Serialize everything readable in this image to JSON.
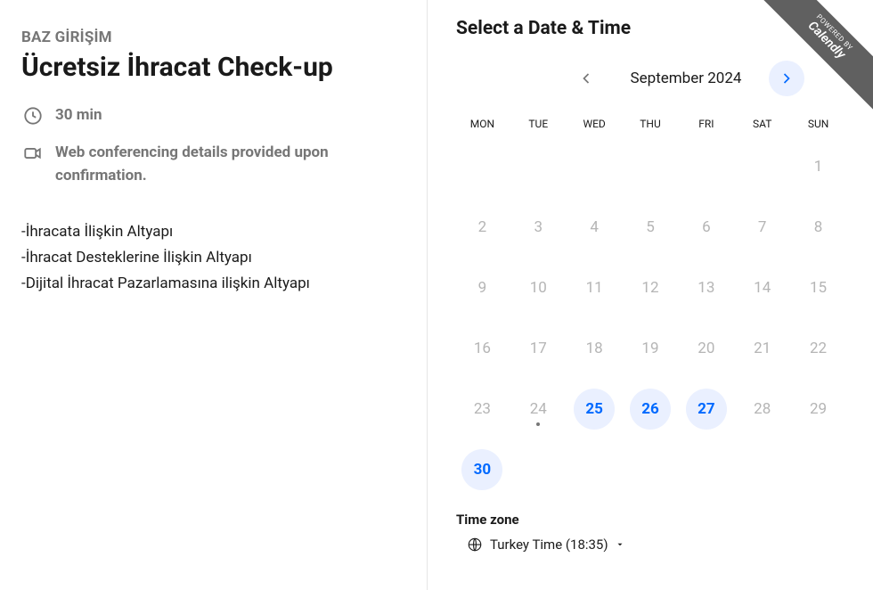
{
  "left": {
    "company": "BAZ GİRİŞİM",
    "title": "Ücretsiz İhracat Check-up",
    "duration": "30 min",
    "conferencing": "Web conferencing details provided upon confirmation.",
    "desc_line1": "-İhracata İlişkin Altyapı",
    "desc_line2": "-İhracat Desteklerine İlişkin Altyapı",
    "desc_line3": "-Dijital İhracat Pazarlamasına ilişkin Altyapı"
  },
  "right": {
    "heading": "Select a Date & Time",
    "month": "September 2024",
    "weekdays": [
      "MON",
      "TUE",
      "WED",
      "THU",
      "FRI",
      "SAT",
      "SUN"
    ],
    "days": [
      {
        "n": "",
        "cls": "empty"
      },
      {
        "n": "",
        "cls": "empty"
      },
      {
        "n": "",
        "cls": "empty"
      },
      {
        "n": "",
        "cls": "empty"
      },
      {
        "n": "",
        "cls": "empty"
      },
      {
        "n": "",
        "cls": "empty"
      },
      {
        "n": "1",
        "cls": ""
      },
      {
        "n": "2",
        "cls": ""
      },
      {
        "n": "3",
        "cls": ""
      },
      {
        "n": "4",
        "cls": ""
      },
      {
        "n": "5",
        "cls": ""
      },
      {
        "n": "6",
        "cls": ""
      },
      {
        "n": "7",
        "cls": ""
      },
      {
        "n": "8",
        "cls": ""
      },
      {
        "n": "9",
        "cls": ""
      },
      {
        "n": "10",
        "cls": ""
      },
      {
        "n": "11",
        "cls": ""
      },
      {
        "n": "12",
        "cls": ""
      },
      {
        "n": "13",
        "cls": ""
      },
      {
        "n": "14",
        "cls": ""
      },
      {
        "n": "15",
        "cls": ""
      },
      {
        "n": "16",
        "cls": ""
      },
      {
        "n": "17",
        "cls": ""
      },
      {
        "n": "18",
        "cls": ""
      },
      {
        "n": "19",
        "cls": ""
      },
      {
        "n": "20",
        "cls": ""
      },
      {
        "n": "21",
        "cls": ""
      },
      {
        "n": "22",
        "cls": ""
      },
      {
        "n": "23",
        "cls": ""
      },
      {
        "n": "24",
        "cls": "today"
      },
      {
        "n": "25",
        "cls": "available"
      },
      {
        "n": "26",
        "cls": "available"
      },
      {
        "n": "27",
        "cls": "available"
      },
      {
        "n": "28",
        "cls": ""
      },
      {
        "n": "29",
        "cls": ""
      },
      {
        "n": "30",
        "cls": "available"
      },
      {
        "n": "",
        "cls": "empty"
      },
      {
        "n": "",
        "cls": "empty"
      },
      {
        "n": "",
        "cls": "empty"
      },
      {
        "n": "",
        "cls": "empty"
      },
      {
        "n": "",
        "cls": "empty"
      },
      {
        "n": "",
        "cls": "empty"
      }
    ],
    "timezone_label": "Time zone",
    "timezone_value": "Turkey Time (18:35)"
  },
  "ribbon": {
    "line1": "POWERED BY",
    "line2": "Calendly"
  }
}
